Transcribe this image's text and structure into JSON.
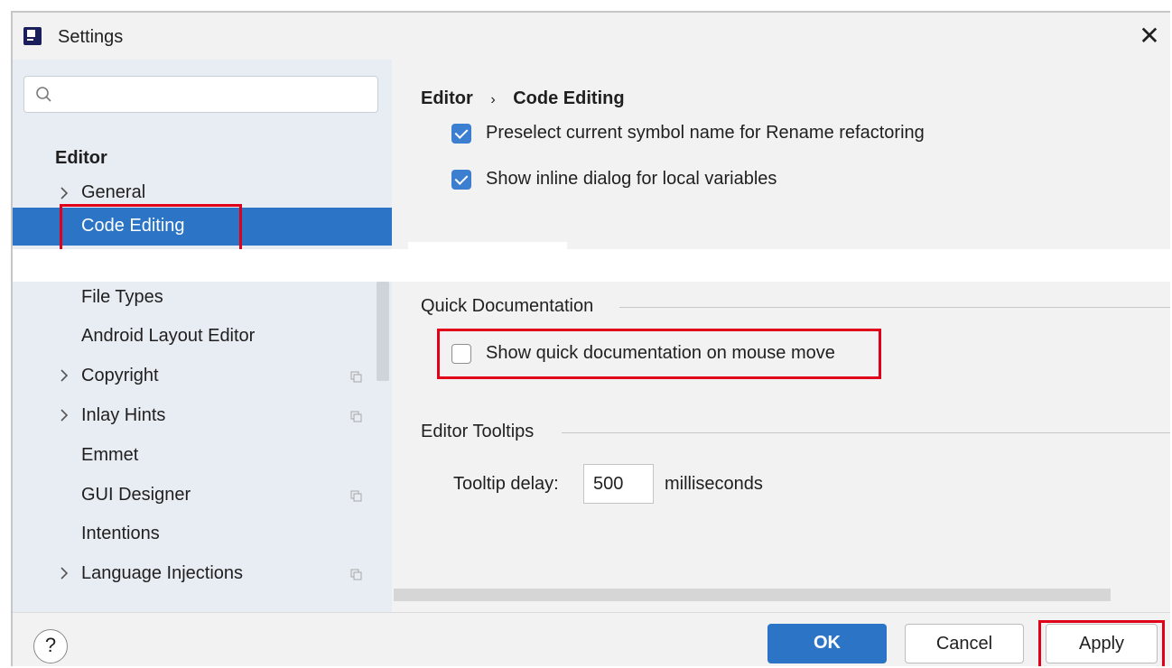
{
  "window": {
    "title": "Settings",
    "close_glyph": "✕"
  },
  "sidebar": {
    "search_placeholder": "",
    "section_title": "Editor",
    "items": [
      {
        "label": "General",
        "expandable": true,
        "has_copy_icon": false
      },
      {
        "label": "Code Editing",
        "expandable": false,
        "selected": true,
        "has_copy_icon": false
      },
      {
        "label": "File Types",
        "expandable": false,
        "has_copy_icon": false
      },
      {
        "label": "Android Layout Editor",
        "expandable": false,
        "has_copy_icon": false
      },
      {
        "label": "Copyright",
        "expandable": true,
        "has_copy_icon": true
      },
      {
        "label": "Inlay Hints",
        "expandable": true,
        "has_copy_icon": true
      },
      {
        "label": "Emmet",
        "expandable": false,
        "has_copy_icon": false
      },
      {
        "label": "GUI Designer",
        "expandable": false,
        "has_copy_icon": true
      },
      {
        "label": "Intentions",
        "expandable": false,
        "has_copy_icon": false
      },
      {
        "label": "Language Injections",
        "expandable": true,
        "has_copy_icon": true
      }
    ],
    "icons": {
      "expand": "chevron-right-icon",
      "search": "search-icon",
      "copy": "copy-icon"
    }
  },
  "content": {
    "breadcrumb": {
      "root": "Editor",
      "separator": "›",
      "current": "Code Editing"
    },
    "checkboxes_top": [
      {
        "label": "Preselect current symbol name for Rename refactoring",
        "checked": true
      },
      {
        "label": "Show inline dialog for local variables",
        "checked": true
      }
    ],
    "quick_doc": {
      "title": "Quick Documentation",
      "checkbox_label": "Show quick documentation on mouse move",
      "checked": false
    },
    "tooltips": {
      "title": "Editor Tooltips",
      "delay_label": "Tooltip delay:",
      "delay_value": "500",
      "unit": "milliseconds"
    }
  },
  "footer": {
    "help": "?",
    "ok": "OK",
    "cancel": "Cancel",
    "apply": "Apply"
  },
  "colors": {
    "accent": "#2c74c5",
    "highlight": "#e1001a",
    "checkbox": "#3c7fd1"
  }
}
